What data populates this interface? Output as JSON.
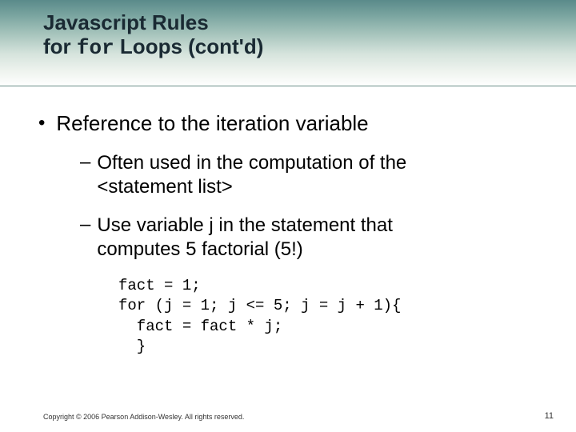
{
  "title": {
    "line1": "Javascript Rules",
    "line2_pre": "for ",
    "line2_code": "for",
    "line2_post": " Loops (cont'd)"
  },
  "bullet": "Reference to the iteration variable",
  "sub1_a": "Often used in the computation of the",
  "sub1_b": "<statement list>",
  "sub2_a": "Use variable j in the statement that",
  "sub2_b": "computes 5 factorial (5!)",
  "code": {
    "l1": "fact = 1;",
    "l2": "for (j = 1; j <= 5; j = j + 1){",
    "l3": "  fact = fact * j;",
    "l4": "  }"
  },
  "footer": {
    "copyright": "Copyright © 2006 Pearson Addison-Wesley. All rights reserved.",
    "page": "11"
  }
}
